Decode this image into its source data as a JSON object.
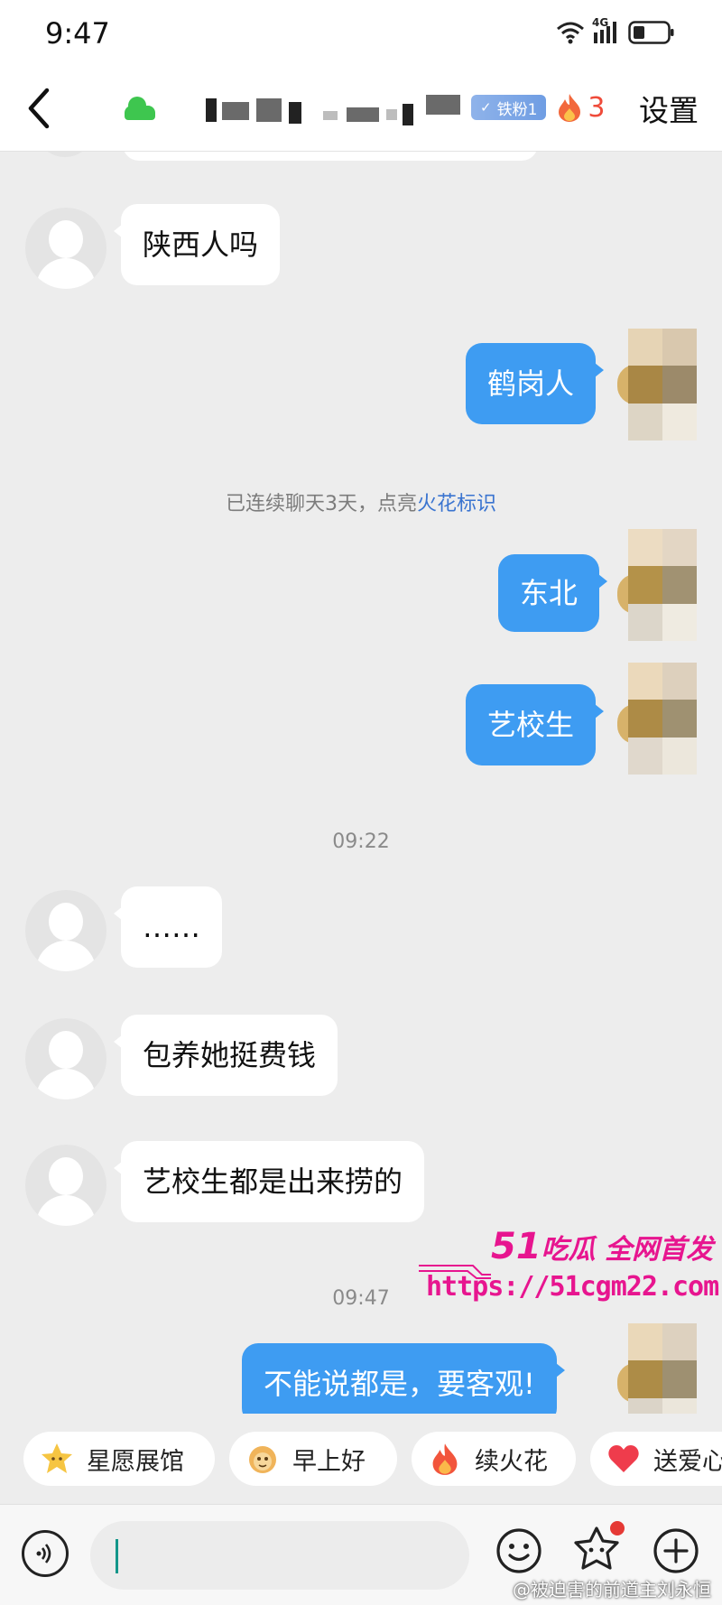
{
  "status_bar": {
    "time": "9:47",
    "network_label": "4G"
  },
  "nav": {
    "fan_badge": "铁粉1",
    "streak_count": "3",
    "settings_label": "设置"
  },
  "messages": [
    {
      "side": "left",
      "text": "陕西人吗"
    },
    {
      "side": "right",
      "text": "鹤岗人"
    },
    {
      "side": "right",
      "text": "东北"
    },
    {
      "side": "right",
      "text": "艺校生"
    },
    {
      "side": "left",
      "text": "……"
    },
    {
      "side": "left",
      "text": "包养她挺费钱"
    },
    {
      "side": "left",
      "text": "艺校生都是出来捞的"
    },
    {
      "side": "right",
      "text": "不能说都是，要客观!"
    }
  ],
  "system_note": {
    "prefix": "已连续聊天3天，点亮",
    "highlight": "火花标识"
  },
  "timestamps": [
    "09:22",
    "09:47"
  ],
  "watermark": {
    "number": "51",
    "title": "吃瓜 全网首发",
    "url": "https://51cgm22.com"
  },
  "quick_actions": [
    {
      "label": "星愿展馆",
      "icon": "star-face-icon"
    },
    {
      "label": "早上好",
      "icon": "sun-face-icon"
    },
    {
      "label": "续火花",
      "icon": "flame-icon"
    },
    {
      "label": "送爱心",
      "icon": "heart-icon"
    }
  ],
  "input": {
    "placeholder": ""
  },
  "credit": "@被迫害的前道主刘永恒",
  "colors": {
    "bubble_right": "#3e9cf2",
    "highlight": "#3a74d0",
    "streak": "#ef4b3a",
    "watermark": "#e7158f"
  }
}
